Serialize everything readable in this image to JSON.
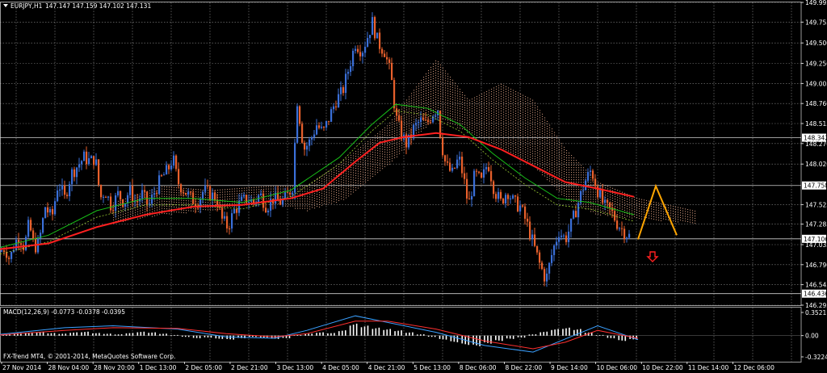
{
  "header": {
    "symbol_label": "EURJPY,H1",
    "ohlc_label": "147.147 147.159 147.102 147.131",
    "macd_label": "MACD(12,26,9) -0.0773 -0.0378 -0.0395",
    "copyright": "FX-Trend MT4, © 2001-2014, MetaQuotes Software Corp."
  },
  "colors": {
    "background": "#000000",
    "grid": "#8a8a8a",
    "bull_candle": "#3a6fd8",
    "bear_candle": "#e8602c",
    "ma_slow": "#ff2020",
    "ma_fast": "#18c018",
    "ma_fast2": "#9acd32",
    "ichimoku_cloud": "#f0b090",
    "zigzag": "#ffa500",
    "macd_main": "#3aa0ff",
    "macd_signal": "#ff3030",
    "macd_hist": "#ffffff",
    "divergence_up": "#00ff00",
    "divergence_down": "#ff2020",
    "price_label_bg": "#ffffff",
    "axis_text": "#ffffff"
  },
  "icons": {
    "sell_arrow": "arrow-down-icon",
    "expand_triangle": "triangle-down-icon"
  },
  "chart_data": {
    "type": "candlestick",
    "symbol": "EURJPY",
    "timeframe": "H1",
    "price_axis": {
      "ticks": [
        "149.995",
        "149.755",
        "149.500",
        "149.250",
        "149.005",
        "148.760",
        "148.515",
        "148.270",
        "148.020",
        "147.525",
        "147.285",
        "147.035",
        "146.790",
        "146.545",
        "146.295"
      ],
      "ylim": [
        146.295,
        149.995
      ]
    },
    "price_labels": [
      {
        "value": "148.342"
      },
      {
        "value": "147.758"
      },
      {
        "value": "147.106"
      },
      {
        "value": "146.436"
      }
    ],
    "time_axis": {
      "labels": [
        "27 Nov 2014",
        "28 Nov 04:00",
        "28 Nov 20:00",
        "1 Dec 13:00",
        "2 Dec 05:00",
        "2 Dec 21:00",
        "3 Dec 13:00",
        "4 Dec 05:00",
        "4 Dec 21:00",
        "5 Dec 13:00",
        "8 Dec 06:00",
        "8 Dec 22:00",
        "9 Dec 14:00",
        "10 Dec 06:00",
        "10 Dec 22:00",
        "11 Dec 14:00",
        "12 Dec 06:00"
      ]
    },
    "macd_axis": {
      "ticks": [
        "0.3521",
        "0.00",
        "-0.3224"
      ],
      "ylim": [
        -0.3224,
        0.3521
      ]
    },
    "price_path": [
      {
        "i": 0,
        "p": 146.95
      },
      {
        "i": 6,
        "p": 147.0
      },
      {
        "i": 12,
        "p": 146.85
      },
      {
        "i": 18,
        "p": 147.05
      },
      {
        "i": 24,
        "p": 147.15
      },
      {
        "i": 30,
        "p": 147.0
      },
      {
        "i": 36,
        "p": 147.3
      },
      {
        "i": 42,
        "p": 147.0
      },
      {
        "i": 48,
        "p": 147.05
      },
      {
        "i": 56,
        "p": 147.5
      },
      {
        "i": 64,
        "p": 147.35
      },
      {
        "i": 72,
        "p": 147.8
      },
      {
        "i": 80,
        "p": 147.6
      },
      {
        "i": 88,
        "p": 147.9
      },
      {
        "i": 96,
        "p": 148.0
      },
      {
        "i": 104,
        "p": 148.1
      },
      {
        "i": 112,
        "p": 148.05
      },
      {
        "i": 118,
        "p": 148.1
      },
      {
        "i": 124,
        "p": 147.6
      },
      {
        "i": 130,
        "p": 147.7
      },
      {
        "i": 138,
        "p": 147.5
      },
      {
        "i": 146,
        "p": 147.65
      },
      {
        "i": 154,
        "p": 147.55
      },
      {
        "i": 160,
        "p": 147.7
      },
      {
        "i": 168,
        "p": 147.55
      },
      {
        "i": 176,
        "p": 147.65
      },
      {
        "i": 184,
        "p": 147.5
      },
      {
        "i": 192,
        "p": 147.7
      },
      {
        "i": 200,
        "p": 147.85
      },
      {
        "i": 208,
        "p": 147.95
      },
      {
        "i": 214,
        "p": 148.1
      },
      {
        "i": 220,
        "p": 147.8
      },
      {
        "i": 228,
        "p": 147.7
      },
      {
        "i": 236,
        "p": 147.6
      },
      {
        "i": 244,
        "p": 147.55
      },
      {
        "i": 252,
        "p": 147.7
      },
      {
        "i": 260,
        "p": 147.65
      },
      {
        "i": 268,
        "p": 147.6
      },
      {
        "i": 274,
        "p": 147.35
      },
      {
        "i": 282,
        "p": 147.25
      },
      {
        "i": 290,
        "p": 147.45
      },
      {
        "i": 298,
        "p": 147.55
      },
      {
        "i": 306,
        "p": 147.6
      },
      {
        "i": 314,
        "p": 147.55
      },
      {
        "i": 322,
        "p": 147.65
      },
      {
        "i": 330,
        "p": 147.5
      },
      {
        "i": 338,
        "p": 147.6
      },
      {
        "i": 346,
        "p": 147.55
      },
      {
        "i": 354,
        "p": 147.6
      },
      {
        "i": 362,
        "p": 147.75
      },
      {
        "i": 368,
        "p": 148.8
      },
      {
        "i": 376,
        "p": 148.2
      },
      {
        "i": 384,
        "p": 148.3
      },
      {
        "i": 392,
        "p": 148.5
      },
      {
        "i": 400,
        "p": 148.4
      },
      {
        "i": 408,
        "p": 148.6
      },
      {
        "i": 416,
        "p": 148.8
      },
      {
        "i": 424,
        "p": 148.9
      },
      {
        "i": 432,
        "p": 149.2
      },
      {
        "i": 440,
        "p": 149.5
      },
      {
        "i": 448,
        "p": 149.4
      },
      {
        "i": 454,
        "p": 149.55
      },
      {
        "i": 461,
        "p": 149.75
      },
      {
        "i": 468,
        "p": 149.5
      },
      {
        "i": 476,
        "p": 149.4
      },
      {
        "i": 484,
        "p": 149.1
      },
      {
        "i": 490,
        "p": 148.6
      },
      {
        "i": 496,
        "p": 148.4
      },
      {
        "i": 504,
        "p": 148.25
      },
      {
        "i": 512,
        "p": 148.45
      },
      {
        "i": 520,
        "p": 148.55
      },
      {
        "i": 528,
        "p": 148.5
      },
      {
        "i": 536,
        "p": 148.65
      },
      {
        "i": 542,
        "p": 148.7
      },
      {
        "i": 546,
        "p": 148.3
      },
      {
        "i": 552,
        "p": 148.0
      },
      {
        "i": 560,
        "p": 147.9
      },
      {
        "i": 568,
        "p": 148.1
      },
      {
        "i": 574,
        "p": 147.85
      },
      {
        "i": 580,
        "p": 147.5
      },
      {
        "i": 588,
        "p": 147.9
      },
      {
        "i": 596,
        "p": 147.8
      },
      {
        "i": 604,
        "p": 148.05
      },
      {
        "i": 612,
        "p": 147.7
      },
      {
        "i": 620,
        "p": 147.55
      },
      {
        "i": 628,
        "p": 147.7
      },
      {
        "i": 636,
        "p": 147.55
      },
      {
        "i": 644,
        "p": 147.5
      },
      {
        "i": 652,
        "p": 147.3
      },
      {
        "i": 660,
        "p": 147.05
      },
      {
        "i": 668,
        "p": 146.8
      },
      {
        "i": 676,
        "p": 146.6
      },
      {
        "i": 684,
        "p": 146.95
      },
      {
        "i": 692,
        "p": 147.2
      },
      {
        "i": 700,
        "p": 147.1
      },
      {
        "i": 708,
        "p": 147.3
      },
      {
        "i": 716,
        "p": 147.55
      },
      {
        "i": 724,
        "p": 147.8
      },
      {
        "i": 732,
        "p": 147.95
      },
      {
        "i": 740,
        "p": 147.7
      },
      {
        "i": 748,
        "p": 147.5
      },
      {
        "i": 756,
        "p": 147.45
      },
      {
        "i": 764,
        "p": 147.3
      },
      {
        "i": 772,
        "p": 147.2
      },
      {
        "i": 780,
        "p": 147.13
      }
    ],
    "ma_slow_path": [
      {
        "i": 0,
        "p": 146.98
      },
      {
        "i": 60,
        "p": 147.05
      },
      {
        "i": 120,
        "p": 147.25
      },
      {
        "i": 180,
        "p": 147.4
      },
      {
        "i": 240,
        "p": 147.5
      },
      {
        "i": 300,
        "p": 147.52
      },
      {
        "i": 360,
        "p": 147.6
      },
      {
        "i": 400,
        "p": 147.72
      },
      {
        "i": 440,
        "p": 148.05
      },
      {
        "i": 470,
        "p": 148.28
      },
      {
        "i": 500,
        "p": 148.35
      },
      {
        "i": 540,
        "p": 148.4
      },
      {
        "i": 580,
        "p": 148.35
      },
      {
        "i": 620,
        "p": 148.2
      },
      {
        "i": 660,
        "p": 148.0
      },
      {
        "i": 700,
        "p": 147.8
      },
      {
        "i": 740,
        "p": 147.72
      },
      {
        "i": 785,
        "p": 147.62
      }
    ],
    "ma_fast_path": [
      {
        "i": 0,
        "p": 147.0
      },
      {
        "i": 60,
        "p": 147.15
      },
      {
        "i": 120,
        "p": 147.45
      },
      {
        "i": 180,
        "p": 147.6
      },
      {
        "i": 240,
        "p": 147.6
      },
      {
        "i": 300,
        "p": 147.55
      },
      {
        "i": 360,
        "p": 147.7
      },
      {
        "i": 420,
        "p": 148.1
      },
      {
        "i": 460,
        "p": 148.5
      },
      {
        "i": 490,
        "p": 148.75
      },
      {
        "i": 530,
        "p": 148.7
      },
      {
        "i": 570,
        "p": 148.5
      },
      {
        "i": 610,
        "p": 148.15
      },
      {
        "i": 650,
        "p": 147.85
      },
      {
        "i": 690,
        "p": 147.6
      },
      {
        "i": 730,
        "p": 147.55
      },
      {
        "i": 785,
        "p": 147.4
      }
    ],
    "cloud_bands": [
      {
        "i": 140,
        "top": 147.55,
        "bottom": 147.3
      },
      {
        "i": 200,
        "top": 147.75,
        "bottom": 147.4
      },
      {
        "i": 260,
        "top": 147.7,
        "bottom": 147.45
      },
      {
        "i": 330,
        "top": 147.75,
        "bottom": 147.55
      },
      {
        "i": 380,
        "top": 147.75,
        "bottom": 147.45
      },
      {
        "i": 430,
        "top": 148.1,
        "bottom": 147.6
      },
      {
        "i": 480,
        "top": 148.5,
        "bottom": 148.0
      },
      {
        "i": 540,
        "top": 149.3,
        "bottom": 148.6
      },
      {
        "i": 580,
        "top": 148.8,
        "bottom": 148.4
      },
      {
        "i": 620,
        "top": 149.0,
        "bottom": 148.2
      },
      {
        "i": 660,
        "top": 148.8,
        "bottom": 148.0
      },
      {
        "i": 700,
        "top": 148.2,
        "bottom": 147.6
      },
      {
        "i": 740,
        "top": 147.8,
        "bottom": 147.4
      },
      {
        "i": 790,
        "top": 147.6,
        "bottom": 147.35
      },
      {
        "i": 860,
        "top": 147.45,
        "bottom": 147.3
      }
    ],
    "zigzag_projection": [
      {
        "i": 790,
        "p": 147.1
      },
      {
        "i": 812,
        "p": 147.75
      },
      {
        "i": 838,
        "p": 147.15
      }
    ],
    "macd_hist": [
      0.02,
      0.04,
      0.05,
      0.06,
      0.04,
      0.03,
      0.05,
      0.06,
      0.04,
      0.03,
      0.02,
      0.04,
      0.06,
      0.05,
      0.03,
      0.01,
      -0.02,
      -0.04,
      -0.03,
      -0.05,
      -0.06,
      -0.04,
      -0.02,
      -0.03,
      -0.05,
      -0.04,
      0.01,
      0.03,
      0.05,
      0.04,
      0.08,
      0.18,
      0.15,
      0.12,
      0.1,
      0.08,
      0.05,
      0.02,
      -0.02,
      -0.06,
      -0.1,
      -0.14,
      -0.16,
      -0.12,
      -0.08,
      -0.05,
      -0.03,
      0.02,
      0.06,
      0.1,
      0.12,
      0.1,
      0.05,
      0.01,
      -0.04,
      -0.08,
      -0.06
    ],
    "macd_main": [
      {
        "i": 0,
        "v": 0.02
      },
      {
        "i": 80,
        "v": 0.12
      },
      {
        "i": 140,
        "v": 0.15
      },
      {
        "i": 220,
        "v": 0.1
      },
      {
        "i": 280,
        "v": -0.02
      },
      {
        "i": 340,
        "v": -0.04
      },
      {
        "i": 380,
        "v": 0.08
      },
      {
        "i": 440,
        "v": 0.3
      },
      {
        "i": 480,
        "v": 0.2
      },
      {
        "i": 540,
        "v": 0.05
      },
      {
        "i": 600,
        "v": -0.15
      },
      {
        "i": 660,
        "v": -0.25
      },
      {
        "i": 700,
        "v": -0.05
      },
      {
        "i": 740,
        "v": 0.15
      },
      {
        "i": 790,
        "v": -0.06
      }
    ],
    "macd_signal": [
      {
        "i": 0,
        "v": 0.01
      },
      {
        "i": 80,
        "v": 0.08
      },
      {
        "i": 140,
        "v": 0.12
      },
      {
        "i": 220,
        "v": 0.11
      },
      {
        "i": 280,
        "v": 0.03
      },
      {
        "i": 340,
        "v": -0.02
      },
      {
        "i": 380,
        "v": 0.03
      },
      {
        "i": 440,
        "v": 0.22
      },
      {
        "i": 480,
        "v": 0.22
      },
      {
        "i": 540,
        "v": 0.1
      },
      {
        "i": 600,
        "v": -0.08
      },
      {
        "i": 660,
        "v": -0.2
      },
      {
        "i": 700,
        "v": -0.1
      },
      {
        "i": 740,
        "v": 0.08
      },
      {
        "i": 790,
        "v": -0.04
      }
    ]
  }
}
